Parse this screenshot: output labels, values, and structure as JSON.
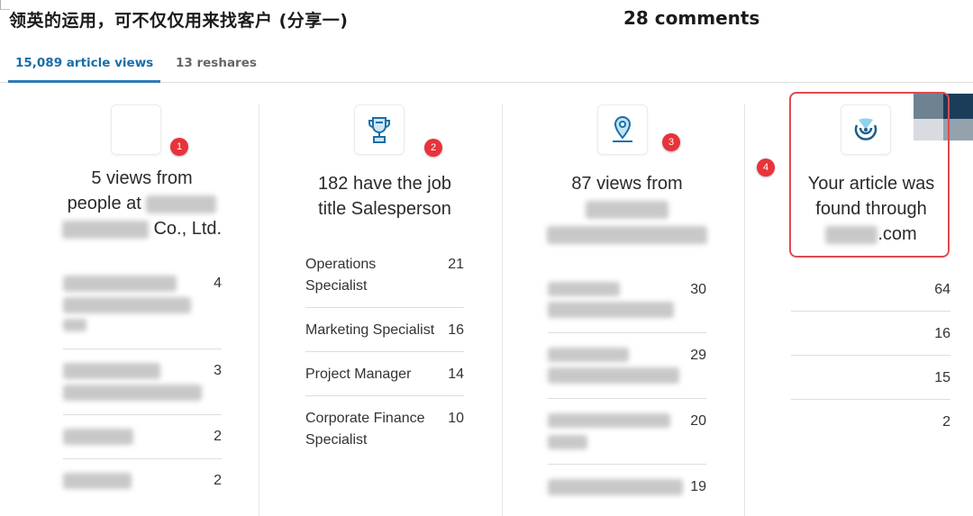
{
  "header": {
    "title": "领英的运用，可不仅仅用来找客户 (分享一)",
    "comments": "28 comments"
  },
  "tabs": [
    {
      "label": "15,089 article views",
      "active": true
    },
    {
      "label": "13 reshares",
      "active": false
    }
  ],
  "columns": [
    {
      "badge": "1",
      "icon": "company-logo-placeholder",
      "headline_line1": "5 views from",
      "headline_line2_prefix": "people at",
      "headline_line3_suffix": "Co., Ltd.",
      "rows": [
        {
          "label": "[blurred company name]",
          "value": "4"
        },
        {
          "label": "[blurred company name]",
          "value": "3"
        },
        {
          "label": "[blurred company name]",
          "value": "2"
        },
        {
          "label": "[blurred company name]",
          "value": "2"
        }
      ]
    },
    {
      "badge": "2",
      "icon": "trophy-icon",
      "headline_line1": "182 have the job",
      "headline_line2": "title Salesperson",
      "rows": [
        {
          "label_line1": "Operations",
          "label_line2": "Specialist",
          "value": "21"
        },
        {
          "label_line1": "Marketing Specialist",
          "value": "16"
        },
        {
          "label_line1": "Project Manager",
          "value": "14"
        },
        {
          "label_line1": "Corporate Finance",
          "label_line2": "Specialist",
          "value": "10"
        }
      ]
    },
    {
      "badge": "3",
      "icon": "location-pin-icon",
      "headline_line1": "87 views from",
      "rows": [
        {
          "label": "[blurred location]",
          "value": "30"
        },
        {
          "label": "[blurred location]",
          "value": "29"
        },
        {
          "label": "[blurred location]",
          "value": "20"
        },
        {
          "label": "[blurred location]",
          "value": "19"
        }
      ]
    },
    {
      "badge": "4",
      "icon": "search-radar-icon",
      "headline_line1": "Your article was",
      "headline_line2": "found through",
      "headline_line3_suffix": ".com",
      "rows": [
        {
          "value": "64"
        },
        {
          "value": "16"
        },
        {
          "value": "15"
        },
        {
          "value": "2"
        }
      ]
    }
  ],
  "colors": {
    "accent": "#1a6ea8",
    "badge": "#e8333a",
    "highlight": "#e04a50"
  }
}
